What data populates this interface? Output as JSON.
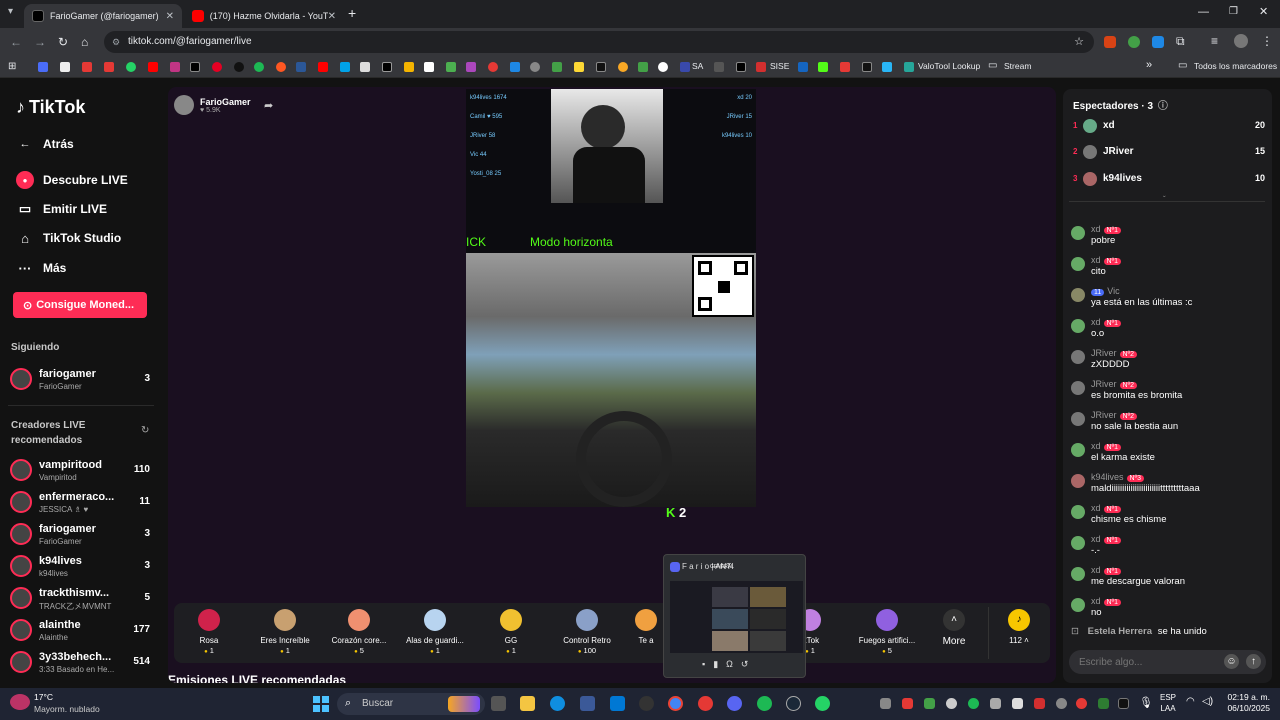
{
  "browser": {
    "tabs": [
      {
        "title": "FarioGamer (@fariogamer) ·"
      },
      {
        "title": "(170) Hazme Olvidarla - YouTub"
      }
    ],
    "url": "tiktok.com/@fariogamer/live",
    "bookmarks": [
      "SA",
      "SISE",
      "ValoTool Lookup",
      "Stream"
    ],
    "all_bookmarks": "Todos los marcadores"
  },
  "sidebar": {
    "logo": "TikTok",
    "back": "Atrás",
    "nav": [
      "Descubre LIVE",
      "Emitir LIVE",
      "TikTok Studio",
      "Más"
    ],
    "coins_button": "Consigue Moned...",
    "following_title": "Siguiendo",
    "following": [
      {
        "name": "fariogamer",
        "sub": "FarioGamer",
        "count": "3"
      }
    ],
    "recommended_title": "Creadores LIVE recomendados",
    "recommended": [
      {
        "name": "vampiritood",
        "sub": "Vampiritod",
        "count": "110"
      },
      {
        "name": "enfermeraco...",
        "sub": "JESSICA ♗ ♥",
        "count": "11"
      },
      {
        "name": "fariogamer",
        "sub": "FarioGamer",
        "count": "3"
      },
      {
        "name": "k94lives",
        "sub": "k94lives",
        "count": "3"
      },
      {
        "name": "trackthismv...",
        "sub": "TRACK乙㐅MVMNT",
        "count": "5"
      },
      {
        "name": "alainthe",
        "sub": "Alainthe",
        "count": "177"
      },
      {
        "name": "3y33behech...",
        "sub": "3:33 Basado en He...",
        "count": "514"
      }
    ]
  },
  "stream": {
    "host": "FarioGamer",
    "likes": "5.9K",
    "overlay_text": "Modo horizonta",
    "overlay_left": "ICK",
    "kick_count": "2",
    "leaderboard_left": [
      {
        "n": "k94lives",
        "s": "1674"
      },
      {
        "n": "Camil ♥",
        "s": "595"
      },
      {
        "n": "JRiver",
        "s": "58"
      },
      {
        "n": "Vic",
        "s": "44"
      },
      {
        "n": "Yosti_08",
        "s": "25"
      }
    ],
    "leaderboard_right": [
      {
        "n": "xd",
        "s": "20"
      },
      {
        "n": "JRiver",
        "s": "15"
      },
      {
        "n": "k94lives",
        "s": "10"
      }
    ],
    "recommended_heading": "Emisiones LIVE recomendadas"
  },
  "gifts": [
    {
      "name": "Rosa",
      "price": "1",
      "color": "#d0224b"
    },
    {
      "name": "Eres Increíble",
      "price": "1",
      "color": "#c8a070"
    },
    {
      "name": "Corazón core...",
      "price": "5",
      "color": "#f09070"
    },
    {
      "name": "Alas de guardi...",
      "price": "1",
      "color": "#b8d4f0"
    },
    {
      "name": "GG",
      "price": "1",
      "color": "#f0c030"
    },
    {
      "name": "Control Retro",
      "price": "100",
      "color": "#8aa0c8"
    },
    {
      "name": "Te a",
      "price": "",
      "color": "#f0a040"
    },
    {
      "name": "ikTok",
      "price": "1",
      "color": "#c080e0"
    },
    {
      "name": "Fuegos artifici...",
      "price": "5",
      "color": "#9060e0"
    }
  ],
  "gift_more": "More",
  "coins": "112",
  "discord_popup": {
    "title": "F a r i o | ANTI",
    "subtitle": "GENERAL"
  },
  "chat": {
    "viewers_label": "Espectadores · 3",
    "viewers": [
      {
        "rank": "1",
        "name": "xd",
        "score": "20"
      },
      {
        "rank": "2",
        "name": "JRiver",
        "score": "15"
      },
      {
        "rank": "3",
        "name": "k94lives",
        "score": "10"
      }
    ],
    "messages": [
      {
        "user": "xd",
        "badge": "Nº1",
        "text": "pobre"
      },
      {
        "user": "xd",
        "badge": "Nº1",
        "text": "cito"
      },
      {
        "user": "Vic",
        "badge": "11",
        "text": "ya está en las últimas :c"
      },
      {
        "user": "xd",
        "badge": "Nº1",
        "text": "o.o"
      },
      {
        "user": "JRiver",
        "badge": "Nº2",
        "text": "zXDDDD"
      },
      {
        "user": "JRiver",
        "badge": "Nº2",
        "text": "es bromita es bromita"
      },
      {
        "user": "JRiver",
        "badge": "Nº2",
        "text": "no sale la bestia aun"
      },
      {
        "user": "xd",
        "badge": "Nº1",
        "text": "el karma existe"
      },
      {
        "user": "k94lives",
        "badge": "Nº3",
        "text": "maldiiiiiiiiiiiiiiiiiiiiiiitttttttttaaa"
      },
      {
        "user": "xd",
        "badge": "Nº1",
        "text": "chisme es chisme"
      },
      {
        "user": "xd",
        "badge": "Nº1",
        "text": "-.-"
      },
      {
        "user": "xd",
        "badge": "Nº1",
        "text": "me descargue valoran"
      },
      {
        "user": "xd",
        "badge": "Nº1",
        "text": "no"
      }
    ],
    "join_user": "Estela Herrera",
    "join_text": "se ha unido",
    "input_placeholder": "Escribe algo..."
  },
  "taskbar": {
    "weather_temp": "17°C",
    "weather_desc": "Mayorm. nublado",
    "search": "Buscar",
    "lang": "ESP",
    "lang2": "LAA",
    "time": "02:19 a. m.",
    "date": "06/10/2025"
  }
}
